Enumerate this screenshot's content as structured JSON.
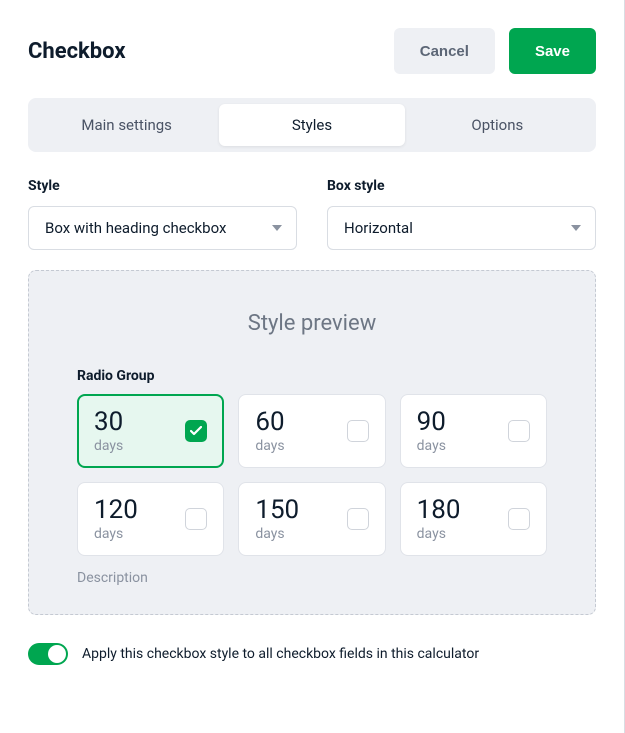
{
  "header": {
    "title": "Checkbox",
    "cancel_label": "Cancel",
    "save_label": "Save"
  },
  "tabs": {
    "main": "Main settings",
    "styles": "Styles",
    "options": "Options",
    "active": "styles"
  },
  "fields": {
    "style": {
      "label": "Style",
      "value": "Box with heading checkbox"
    },
    "box_style": {
      "label": "Box style",
      "value": "Horizontal"
    }
  },
  "preview": {
    "title": "Style preview",
    "group_label": "Radio Group",
    "description": "Description",
    "unit": "days",
    "items": [
      {
        "value": "30",
        "selected": true
      },
      {
        "value": "60",
        "selected": false
      },
      {
        "value": "90",
        "selected": false
      },
      {
        "value": "120",
        "selected": false
      },
      {
        "value": "150",
        "selected": false
      },
      {
        "value": "180",
        "selected": false
      }
    ]
  },
  "apply_all": {
    "label": "Apply this checkbox style to all checkbox fields in this calculator",
    "on": true
  }
}
